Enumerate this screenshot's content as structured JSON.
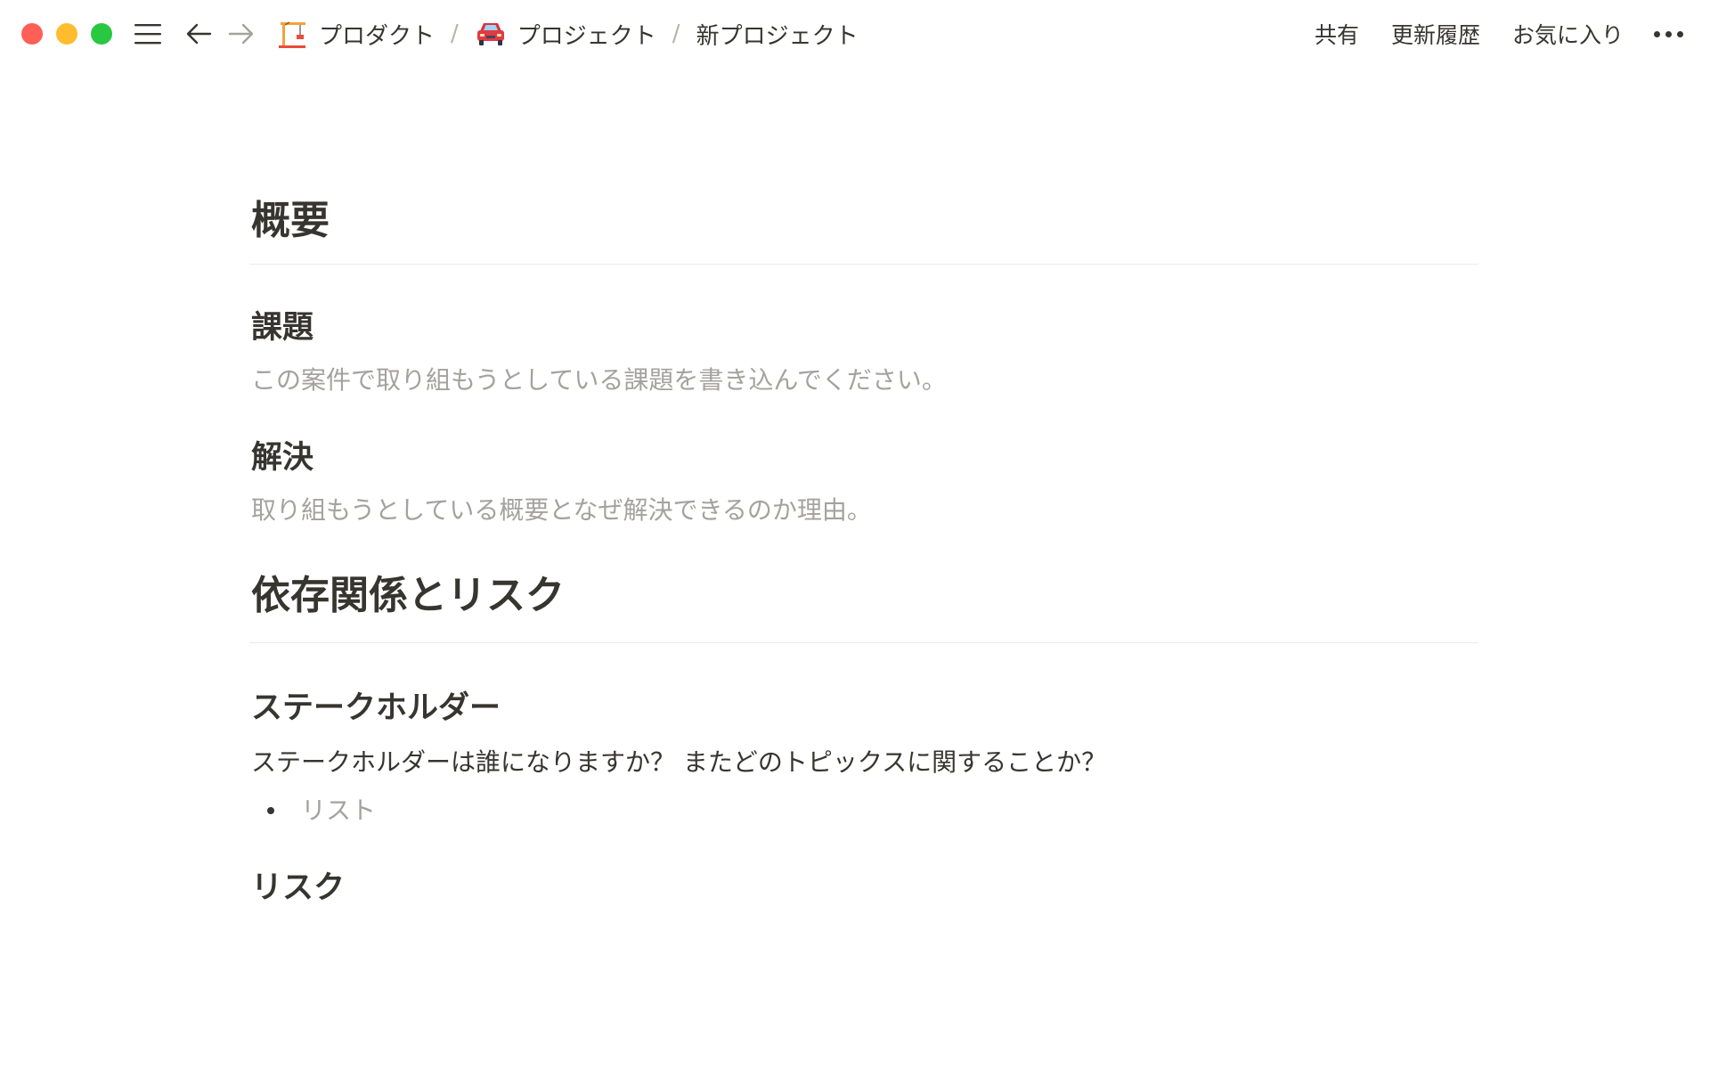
{
  "window": {
    "controls": [
      "close",
      "minimize",
      "zoom"
    ]
  },
  "nav": {
    "menu_icon": "hamburger-menu-icon",
    "back_icon": "arrow-left-icon",
    "forward_icon": "arrow-right-icon"
  },
  "breadcrumbs": [
    {
      "icon": "crane-emoji",
      "label": "プロダクト"
    },
    {
      "icon": "car-emoji",
      "label": "プロジェクト"
    },
    {
      "label": "新プロジェクト"
    }
  ],
  "breadcrumb_separator": "/",
  "actions": {
    "share": "共有",
    "history": "更新履歴",
    "favorite": "お気に入り",
    "more_icon": "more-horizontal-icon"
  },
  "content": {
    "overview_heading": "概要",
    "issue_heading": "課題",
    "issue_placeholder": "この案件で取り組もうとしている課題を書き込んでください。",
    "solution_heading": "解決",
    "solution_placeholder": "取り組もうとしている概要となぜ解決できるのか理由。",
    "deps_heading": "依存関係とリスク",
    "stakeholders_heading": "ステークホルダー",
    "stakeholders_text": "ステークホルダーは誰になりますか？ またどのトピックスに関することか？",
    "list_placeholder": "リスト",
    "risk_heading": "リスク"
  },
  "colors": {
    "text": "#37352f",
    "placeholder": "#a3a29e",
    "divider": "#e9e9e7",
    "close": "#fe5f57",
    "minimize": "#febc2e",
    "zoom": "#28c840"
  }
}
